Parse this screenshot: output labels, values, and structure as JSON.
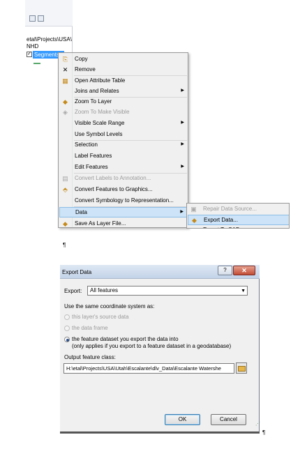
{
  "toc": {
    "path_text": "etal\\Projects\\USA\\",
    "group_label": "NHD",
    "layer_label": "Segments",
    "check_mark": "✓"
  },
  "context_menu": {
    "items": [
      {
        "label": "Copy",
        "icon": "copy-icon",
        "glyph": "⎘",
        "submenu": false,
        "disabled": false
      },
      {
        "label": "Remove",
        "icon": "remove-icon",
        "glyph": "✕",
        "submenu": false,
        "disabled": false
      },
      {
        "label": "Open Attribute Table",
        "icon": "table-icon",
        "glyph": "▦",
        "submenu": false,
        "disabled": false
      },
      {
        "label": "Joins and Relates",
        "icon": "",
        "glyph": "",
        "submenu": true,
        "disabled": false
      },
      {
        "label": "Zoom To Layer",
        "icon": "zoom-to-layer-icon",
        "glyph": "◆",
        "submenu": false,
        "disabled": false
      },
      {
        "label": "Zoom To Make Visible",
        "icon": "zoom-visible-icon",
        "glyph": "◈",
        "submenu": false,
        "disabled": true
      },
      {
        "label": "Visible Scale Range",
        "icon": "",
        "glyph": "",
        "submenu": true,
        "disabled": false
      },
      {
        "label": "Use Symbol Levels",
        "icon": "",
        "glyph": "",
        "submenu": false,
        "disabled": false
      },
      {
        "label": "Selection",
        "icon": "",
        "glyph": "",
        "submenu": true,
        "disabled": false
      },
      {
        "label": "Label Features",
        "icon": "",
        "glyph": "",
        "submenu": false,
        "disabled": false
      },
      {
        "label": "Edit Features",
        "icon": "",
        "glyph": "",
        "submenu": true,
        "disabled": false
      },
      {
        "label": "Convert Labels to Annotation...",
        "icon": "convert-labels-icon",
        "glyph": "▤",
        "submenu": false,
        "disabled": true
      },
      {
        "label": "Convert Features to Graphics...",
        "icon": "convert-graphics-icon",
        "glyph": "⬘",
        "submenu": false,
        "disabled": false
      },
      {
        "label": "Convert Symbology to Representation...",
        "icon": "",
        "glyph": "",
        "submenu": false,
        "disabled": false
      },
      {
        "label": "Data",
        "icon": "",
        "glyph": "",
        "submenu": true,
        "disabled": false,
        "highlighted": true
      },
      {
        "label": "Save As Layer File...",
        "icon": "layer-file-icon",
        "glyph": "◆",
        "submenu": false,
        "disabled": false
      }
    ],
    "arrow": "▶"
  },
  "submenu": {
    "items": [
      {
        "label": "Repair Data Source...",
        "disabled": true,
        "glyph": "▣"
      },
      {
        "label": "Export Data...",
        "disabled": false,
        "highlighted": true,
        "glyph": "◆"
      },
      {
        "label": "Export To CAD...",
        "disabled": false,
        "glyph": "▭"
      }
    ]
  },
  "pilcrow": "¶",
  "dialog": {
    "title": "Export Data",
    "help_glyph": "?",
    "close_glyph": "✕",
    "export_label": "Export:",
    "export_value": "All features",
    "export_dropdown_glyph": "▼",
    "coord_label": "Use the same coordinate system as:",
    "radio_options": [
      {
        "label": "this layer's source data",
        "disabled": true,
        "selected": false
      },
      {
        "label": "the data frame",
        "disabled": true,
        "selected": false
      },
      {
        "label": "the feature dataset you export the data into",
        "disabled": false,
        "selected": true
      }
    ],
    "radio_note": "(only applies if you export to a feature dataset in a geodatabase)",
    "output_label": "Output feature class:",
    "output_path": "H:\\etal\\Projects\\USA\\Utah\\Escalante\\dlv_Data\\Escalante Watershe",
    "ok_label": "OK",
    "cancel_label": "Cancel",
    "resize_glyph": "⋰"
  }
}
